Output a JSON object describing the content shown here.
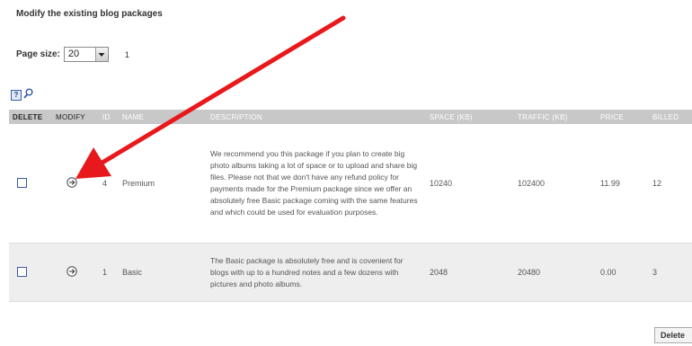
{
  "page": {
    "title": "Modify the existing blog packages"
  },
  "pager": {
    "label": "Page size:",
    "page_size": "20",
    "current_page": "1"
  },
  "table": {
    "headers": {
      "delete": "DELETE",
      "modify": "MODIFY",
      "id": "ID",
      "name": "NAME",
      "description": "DESCRIPTION",
      "space": "SPACE (KB)",
      "traffic": "TRAFFIC (KB)",
      "price": "PRICE",
      "billed": "BILLED"
    },
    "rows": [
      {
        "id": "4",
        "name": "Premium",
        "description": "We recommend you this package if you plan to create big photo albums taking a lot of space or to upload and share big files. Please not that we don't have any refund policy for payments made for the Premium package since we offer an absolutely free Basic package coming with the same features and which could be used for evaluation purposes.",
        "space": "10240",
        "traffic": "102400",
        "price": "11.99",
        "billed": "12"
      },
      {
        "id": "1",
        "name": "Basic",
        "description": "The Basic package is absolutely free and is covenient for blogs with up to a hundred notes and a few dozens with pictures and photo albums.",
        "space": "2048",
        "traffic": "20480",
        "price": "0.00",
        "billed": "3"
      }
    ]
  },
  "actions": {
    "delete_label": "Delete"
  },
  "colors": {
    "header_bg": "#c8c8c8",
    "row_alt_bg": "#eeeeee",
    "annotation_arrow": "#e8191d"
  },
  "icons": {
    "help": "help-icon",
    "search": "search-icon",
    "modify": "circle-arrow-right-icon",
    "dropdown": "chevron-down-icon"
  }
}
